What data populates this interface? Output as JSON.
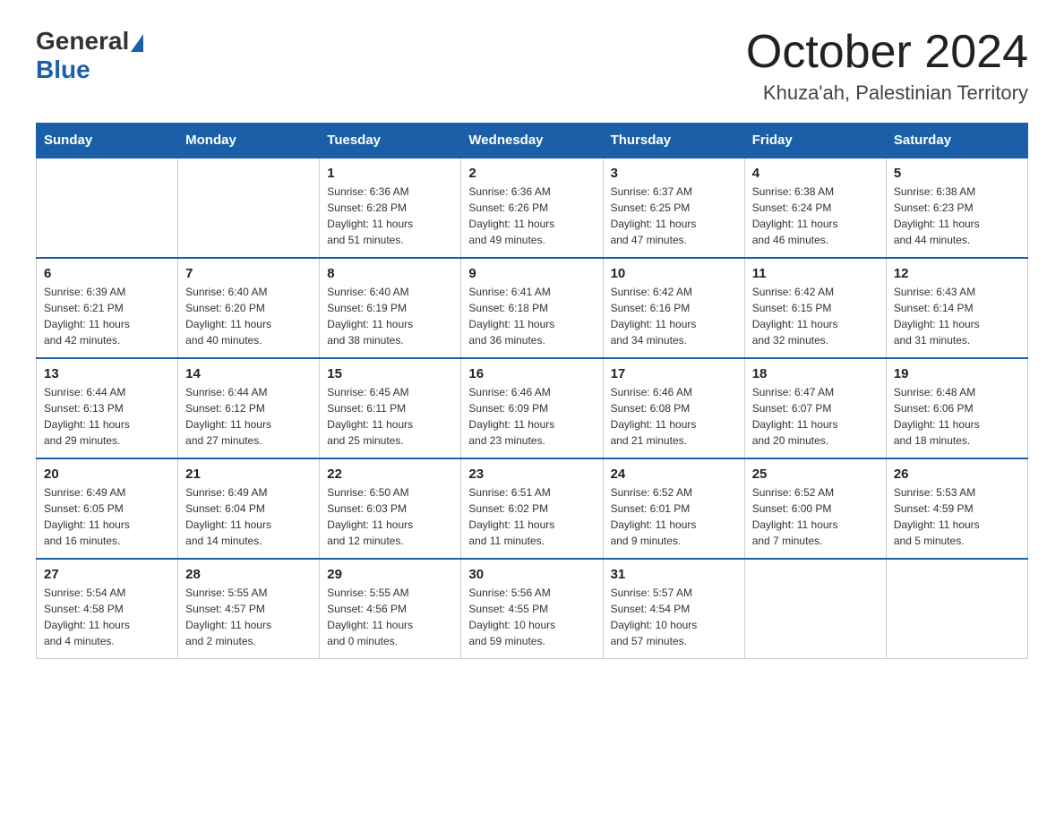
{
  "header": {
    "logo_general": "General",
    "logo_blue": "Blue",
    "month_title": "October 2024",
    "location": "Khuza'ah, Palestinian Territory"
  },
  "weekdays": [
    "Sunday",
    "Monday",
    "Tuesday",
    "Wednesday",
    "Thursday",
    "Friday",
    "Saturday"
  ],
  "weeks": [
    [
      {
        "day": "",
        "info": ""
      },
      {
        "day": "",
        "info": ""
      },
      {
        "day": "1",
        "info": "Sunrise: 6:36 AM\nSunset: 6:28 PM\nDaylight: 11 hours\nand 51 minutes."
      },
      {
        "day": "2",
        "info": "Sunrise: 6:36 AM\nSunset: 6:26 PM\nDaylight: 11 hours\nand 49 minutes."
      },
      {
        "day": "3",
        "info": "Sunrise: 6:37 AM\nSunset: 6:25 PM\nDaylight: 11 hours\nand 47 minutes."
      },
      {
        "day": "4",
        "info": "Sunrise: 6:38 AM\nSunset: 6:24 PM\nDaylight: 11 hours\nand 46 minutes."
      },
      {
        "day": "5",
        "info": "Sunrise: 6:38 AM\nSunset: 6:23 PM\nDaylight: 11 hours\nand 44 minutes."
      }
    ],
    [
      {
        "day": "6",
        "info": "Sunrise: 6:39 AM\nSunset: 6:21 PM\nDaylight: 11 hours\nand 42 minutes."
      },
      {
        "day": "7",
        "info": "Sunrise: 6:40 AM\nSunset: 6:20 PM\nDaylight: 11 hours\nand 40 minutes."
      },
      {
        "day": "8",
        "info": "Sunrise: 6:40 AM\nSunset: 6:19 PM\nDaylight: 11 hours\nand 38 minutes."
      },
      {
        "day": "9",
        "info": "Sunrise: 6:41 AM\nSunset: 6:18 PM\nDaylight: 11 hours\nand 36 minutes."
      },
      {
        "day": "10",
        "info": "Sunrise: 6:42 AM\nSunset: 6:16 PM\nDaylight: 11 hours\nand 34 minutes."
      },
      {
        "day": "11",
        "info": "Sunrise: 6:42 AM\nSunset: 6:15 PM\nDaylight: 11 hours\nand 32 minutes."
      },
      {
        "day": "12",
        "info": "Sunrise: 6:43 AM\nSunset: 6:14 PM\nDaylight: 11 hours\nand 31 minutes."
      }
    ],
    [
      {
        "day": "13",
        "info": "Sunrise: 6:44 AM\nSunset: 6:13 PM\nDaylight: 11 hours\nand 29 minutes."
      },
      {
        "day": "14",
        "info": "Sunrise: 6:44 AM\nSunset: 6:12 PM\nDaylight: 11 hours\nand 27 minutes."
      },
      {
        "day": "15",
        "info": "Sunrise: 6:45 AM\nSunset: 6:11 PM\nDaylight: 11 hours\nand 25 minutes."
      },
      {
        "day": "16",
        "info": "Sunrise: 6:46 AM\nSunset: 6:09 PM\nDaylight: 11 hours\nand 23 minutes."
      },
      {
        "day": "17",
        "info": "Sunrise: 6:46 AM\nSunset: 6:08 PM\nDaylight: 11 hours\nand 21 minutes."
      },
      {
        "day": "18",
        "info": "Sunrise: 6:47 AM\nSunset: 6:07 PM\nDaylight: 11 hours\nand 20 minutes."
      },
      {
        "day": "19",
        "info": "Sunrise: 6:48 AM\nSunset: 6:06 PM\nDaylight: 11 hours\nand 18 minutes."
      }
    ],
    [
      {
        "day": "20",
        "info": "Sunrise: 6:49 AM\nSunset: 6:05 PM\nDaylight: 11 hours\nand 16 minutes."
      },
      {
        "day": "21",
        "info": "Sunrise: 6:49 AM\nSunset: 6:04 PM\nDaylight: 11 hours\nand 14 minutes."
      },
      {
        "day": "22",
        "info": "Sunrise: 6:50 AM\nSunset: 6:03 PM\nDaylight: 11 hours\nand 12 minutes."
      },
      {
        "day": "23",
        "info": "Sunrise: 6:51 AM\nSunset: 6:02 PM\nDaylight: 11 hours\nand 11 minutes."
      },
      {
        "day": "24",
        "info": "Sunrise: 6:52 AM\nSunset: 6:01 PM\nDaylight: 11 hours\nand 9 minutes."
      },
      {
        "day": "25",
        "info": "Sunrise: 6:52 AM\nSunset: 6:00 PM\nDaylight: 11 hours\nand 7 minutes."
      },
      {
        "day": "26",
        "info": "Sunrise: 5:53 AM\nSunset: 4:59 PM\nDaylight: 11 hours\nand 5 minutes."
      }
    ],
    [
      {
        "day": "27",
        "info": "Sunrise: 5:54 AM\nSunset: 4:58 PM\nDaylight: 11 hours\nand 4 minutes."
      },
      {
        "day": "28",
        "info": "Sunrise: 5:55 AM\nSunset: 4:57 PM\nDaylight: 11 hours\nand 2 minutes."
      },
      {
        "day": "29",
        "info": "Sunrise: 5:55 AM\nSunset: 4:56 PM\nDaylight: 11 hours\nand 0 minutes."
      },
      {
        "day": "30",
        "info": "Sunrise: 5:56 AM\nSunset: 4:55 PM\nDaylight: 10 hours\nand 59 minutes."
      },
      {
        "day": "31",
        "info": "Sunrise: 5:57 AM\nSunset: 4:54 PM\nDaylight: 10 hours\nand 57 minutes."
      },
      {
        "day": "",
        "info": ""
      },
      {
        "day": "",
        "info": ""
      }
    ]
  ]
}
